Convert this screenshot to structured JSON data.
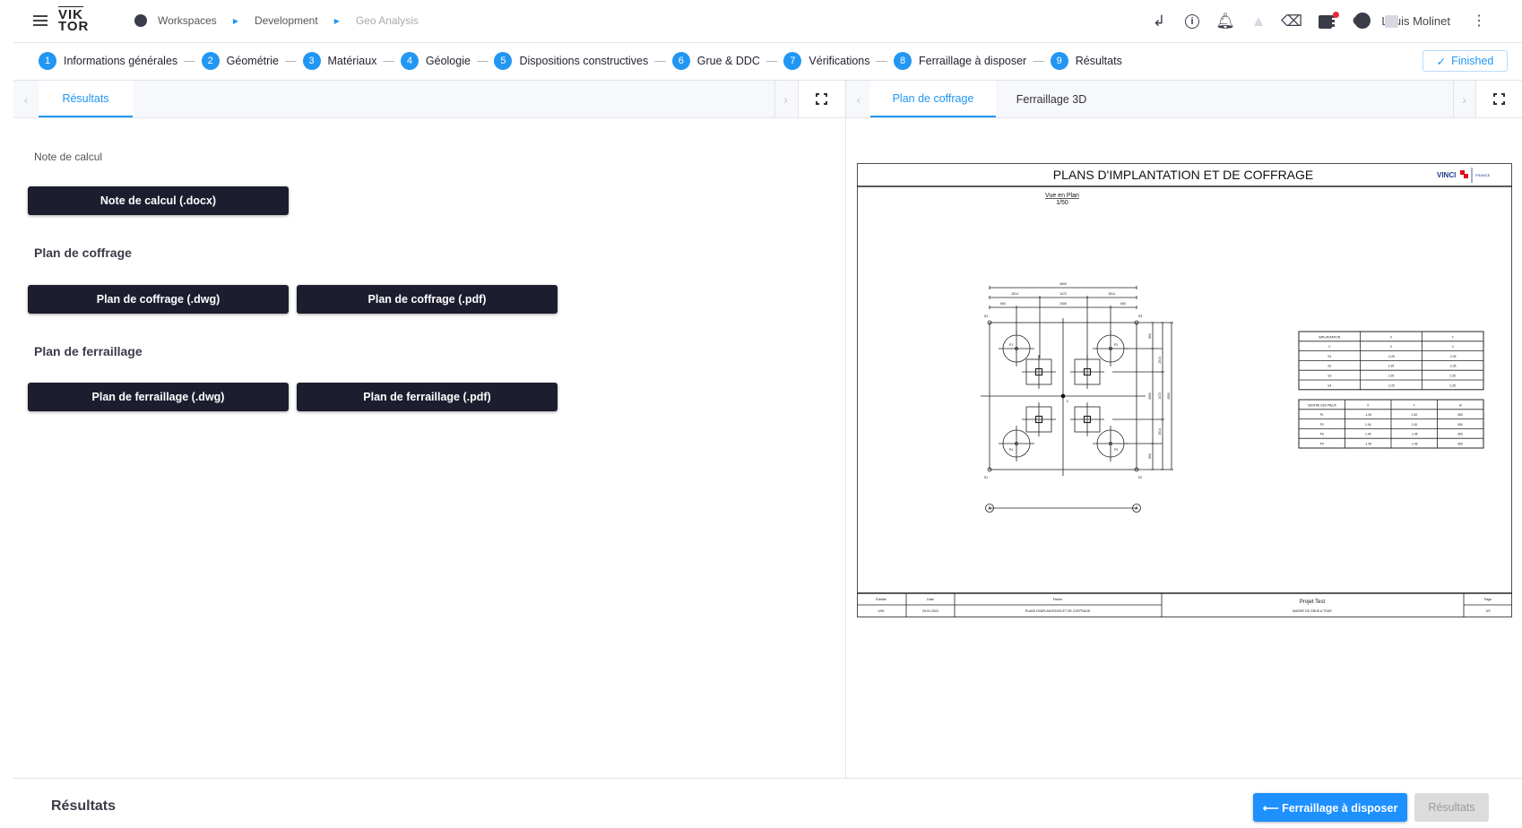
{
  "header": {
    "logo": [
      "VIK",
      "TOR"
    ],
    "breadcrumb": [
      "Workspaces",
      "Development",
      "Geo Analysis"
    ],
    "user": "Louis Molinet"
  },
  "steps": [
    {
      "num": "1",
      "label": "Informations générales"
    },
    {
      "num": "2",
      "label": "Géométrie"
    },
    {
      "num": "3",
      "label": "Matériaux"
    },
    {
      "num": "4",
      "label": "Géologie"
    },
    {
      "num": "5",
      "label": "Dispositions constructives"
    },
    {
      "num": "6",
      "label": "Grue & DDC"
    },
    {
      "num": "7",
      "label": "Vérifications"
    },
    {
      "num": "8",
      "label": "Ferraillage à disposer"
    },
    {
      "num": "9",
      "label": "Résultats"
    }
  ],
  "toolbar": {
    "icons": [
      "return-icon",
      "info-icon",
      "bell-icon",
      "warning-icon",
      "clear-icon",
      "save-icon",
      "history-icon",
      "inbox-icon"
    ],
    "finished_label": "Finished"
  },
  "left_pane": {
    "tabs": [
      "Résultats"
    ],
    "note_label": "Note de calcul",
    "note_button": "Note de calcul (.docx)",
    "coffrage_heading": "Plan de coffrage",
    "coffrage_buttons": [
      "Plan de coffrage (.dwg)",
      "Plan de coffrage (.pdf)"
    ],
    "ferraillage_heading": "Plan de ferraillage",
    "ferraillage_buttons": [
      "Plan de ferraillage (.dwg)",
      "Plan de ferraillage (.pdf)"
    ]
  },
  "right_pane": {
    "tabs": [
      "Plan de coffrage",
      "Ferraillage 3D"
    ]
  },
  "drawing": {
    "title": "PLANS D'IMPLANTATION ET DE COFFRAGE",
    "logo": "VINCI CONSTRUCTION FRANCE",
    "view_title": "Vue en Plan",
    "view_scale": "1/50",
    "dims_top": [
      "4500",
      "1514",
      "1472",
      "1514",
      "600",
      "2400",
      "600"
    ],
    "dims_right": [
      "600",
      "1514",
      "2800",
      "1472",
      "4500",
      "1514",
      "600"
    ],
    "corner_labels": [
      "S4",
      "S3",
      "S1",
      "S2",
      "C"
    ],
    "pile_labels": [
      "P1",
      "P2",
      "P3",
      "P4"
    ],
    "section_label": "A",
    "implantation_table": {
      "headers": [
        "IMPLANTATION",
        "X",
        "Y"
      ],
      "rows": [
        [
          "C",
          "0",
          "0"
        ],
        [
          "S1",
          "-2.25",
          "-2.25"
        ],
        [
          "S2",
          "2.25",
          "-2.25"
        ],
        [
          "S3",
          "2.25",
          "2.25"
        ],
        [
          "S4",
          "-2.25",
          "2.25"
        ]
      ]
    },
    "pieux_table": {
      "headers": [
        "CENTRE DES PIEUX",
        "X",
        "Y",
        "Ø"
      ],
      "rows": [
        [
          "P1",
          "-1.45",
          "1.45",
          "800"
        ],
        [
          "P2",
          "1.45",
          "1.45",
          "800"
        ],
        [
          "P3",
          "1.45",
          "-1.45",
          "800"
        ],
        [
          "P4",
          "-1.45",
          "-1.45",
          "800"
        ]
      ]
    },
    "cartouche": {
      "echelle_label": "Échelle",
      "echelle": "1/50",
      "date_label": "Date",
      "date": "09.01.2023",
      "fichier_label": "Fichier",
      "fichier": "PLANS D'IMPLANTATION ET DE COFFRAGE",
      "projet": "Projet Test",
      "ouvrage": "MASSIF DE GRUE A TOUR",
      "page_label": "Page",
      "page": "2/3"
    }
  },
  "bottom": {
    "title": "Résultats",
    "prev_button": "⟵ Ferraillage à disposer",
    "next_button": "Résultats"
  },
  "colors": {
    "accent": "#2196f3",
    "dark_button": "#1c1d2e",
    "notification": "#e8293b"
  }
}
